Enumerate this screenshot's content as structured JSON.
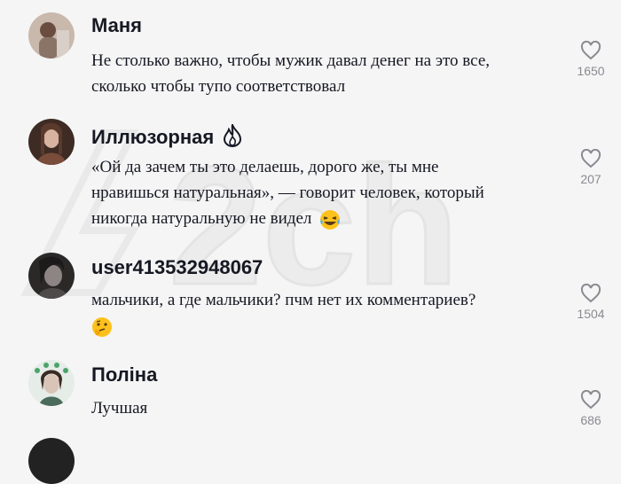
{
  "watermark": "2ch",
  "comments": [
    {
      "author": "Маня",
      "text_lines": [
        "Не столько важно, чтобы мужик давал денег на это все,",
        "сколько чтобы тупо соответствовал"
      ],
      "likes": "1650",
      "avatar_color": "#8a7468"
    },
    {
      "author": "Иллюзорная",
      "author_icon": "fire-icon",
      "text_lines": [
        "«Ой да зачем ты это делаешь, дорого же, ты мне",
        "нравишься натуральная», — говорит человек, который",
        "никогда натуральную не видел"
      ],
      "text_emoji": "laughing-tears-emoji",
      "likes": "207",
      "avatar_color": "#5a3a2c"
    },
    {
      "author": "user413532948067",
      "text_lines": [
        "мальчики, а где мальчики? пчм нет их комментариев?"
      ],
      "text_emoji": "thinking-emoji",
      "likes": "1504",
      "avatar_color": "#3c3838"
    },
    {
      "author": "Полiна",
      "text_lines": [
        "Лучшая"
      ],
      "likes": "686",
      "avatar_color": "#4b6b5c"
    }
  ]
}
